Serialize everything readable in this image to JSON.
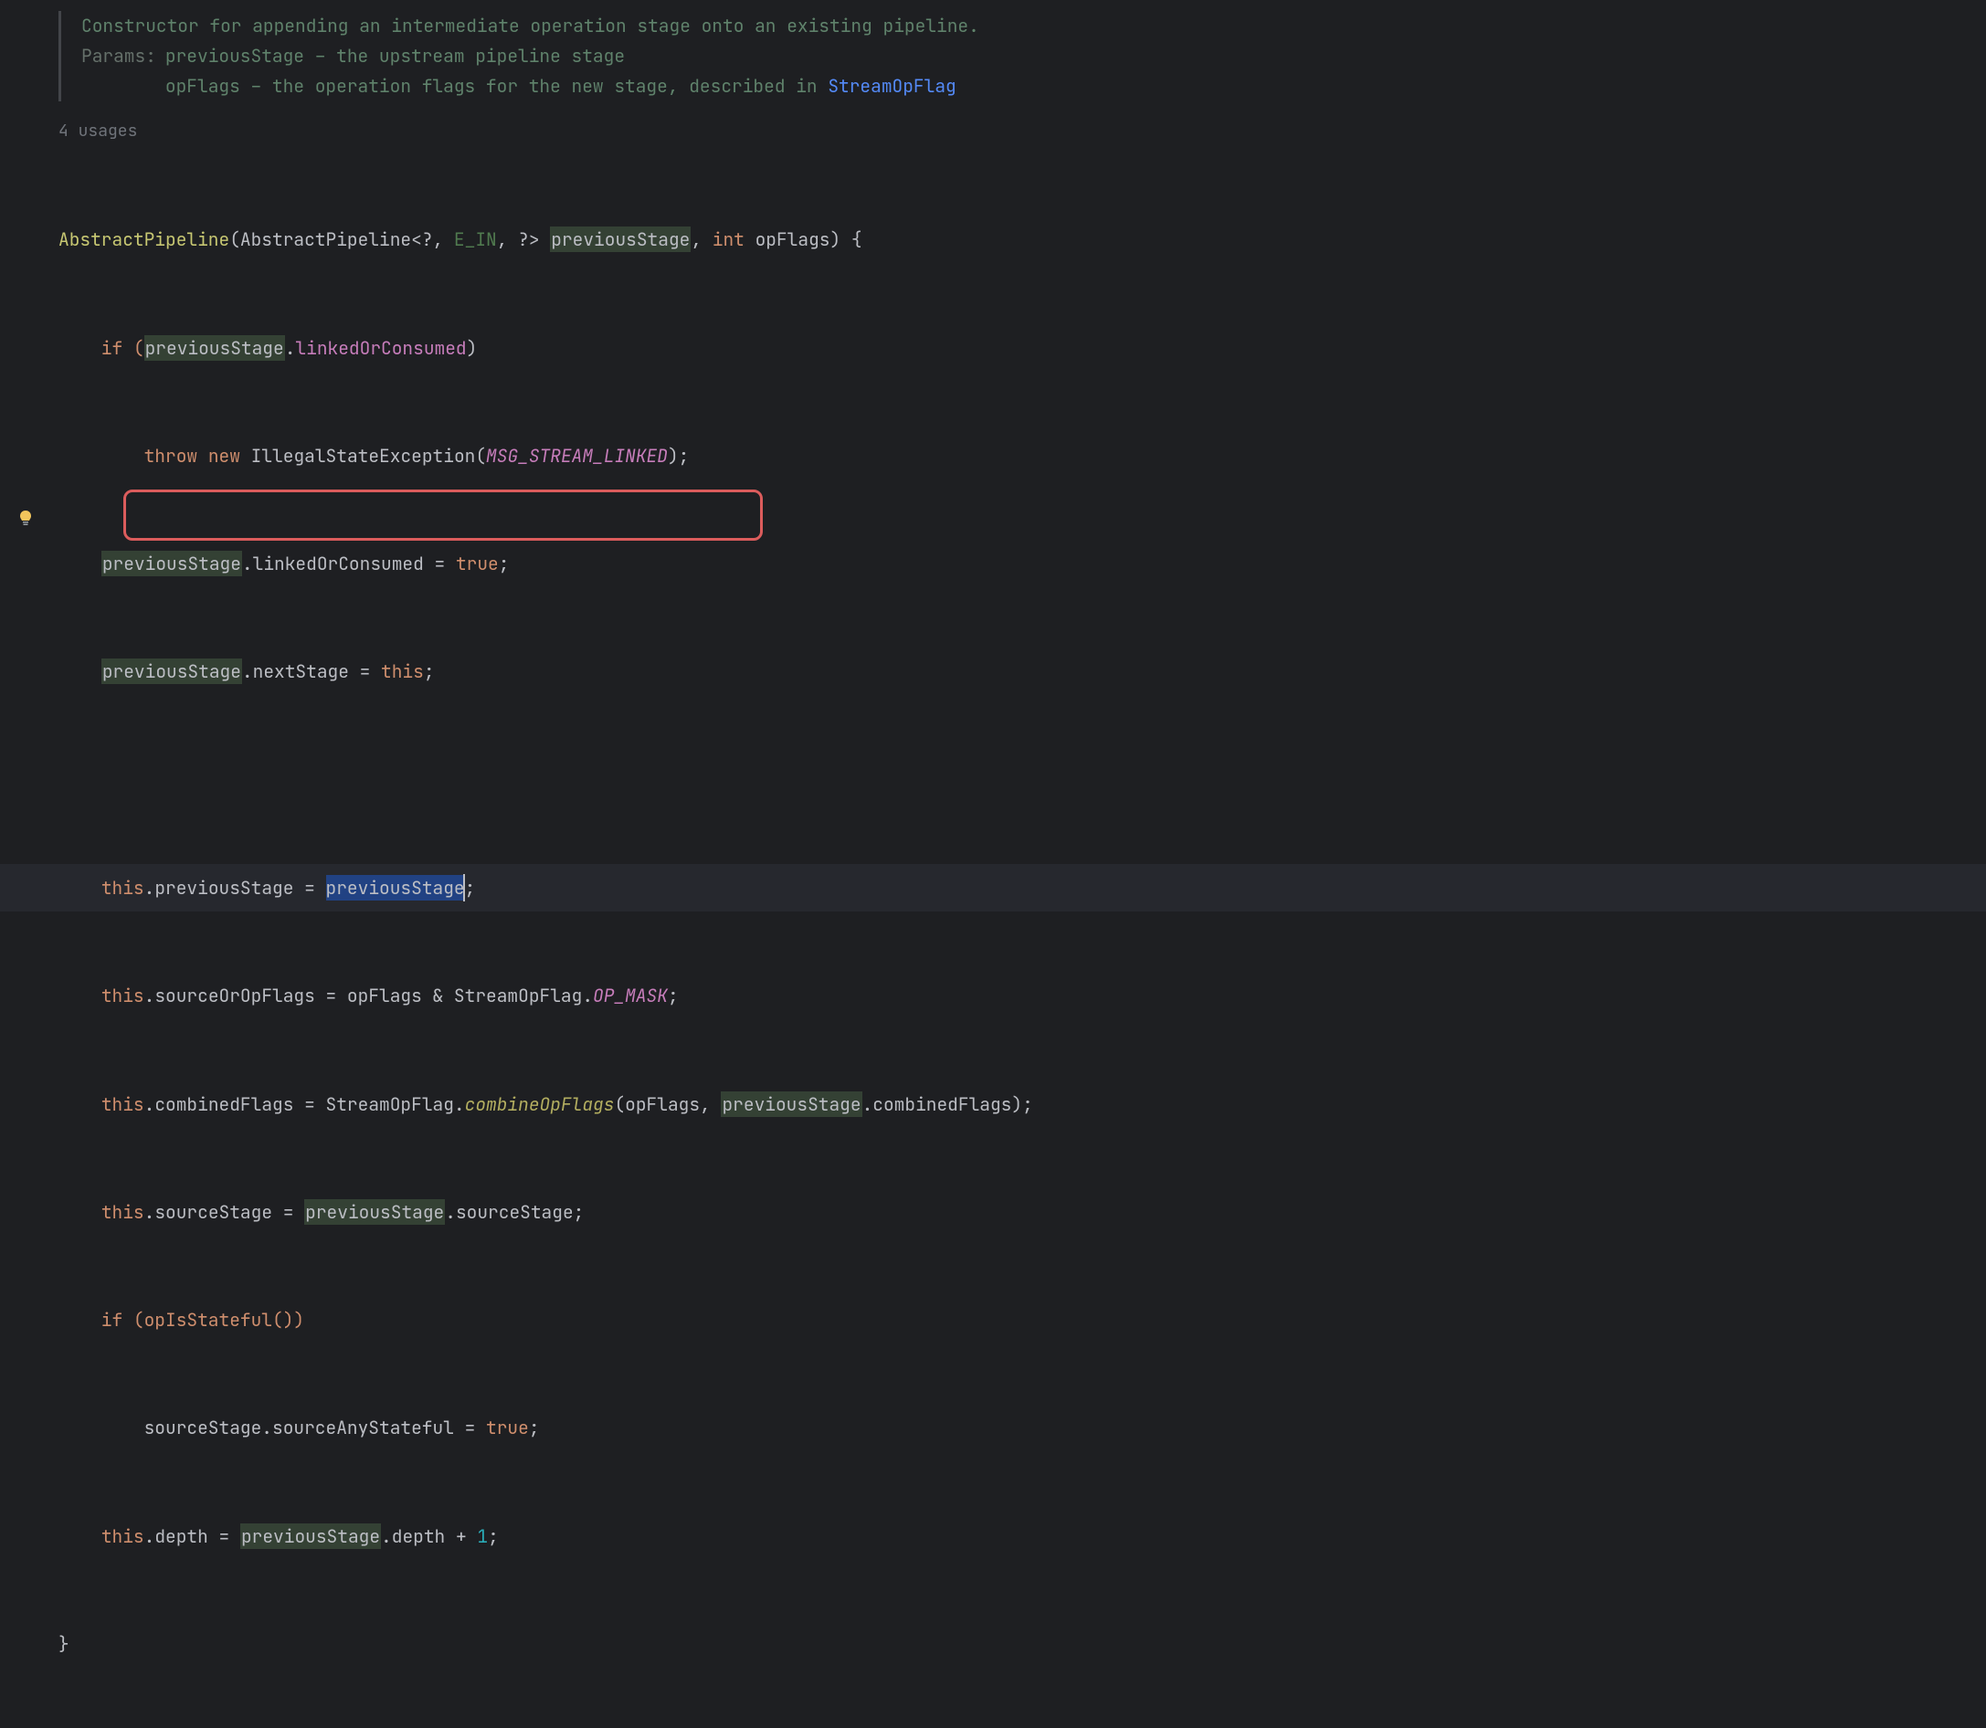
{
  "doc": {
    "summary": "Constructor for appending an intermediate operation stage onto an existing pipeline.",
    "params_label": "Params:",
    "param1_name": "previousStage",
    "param1_text": " – the upstream pipeline stage",
    "param2_name": "opFlags",
    "param2_text": " – the operation flags for the new stage, described in ",
    "param2_link": "StreamOpFlag"
  },
  "usages_text": "4 usages",
  "code": {
    "ctor_name": "AbstractPipeline",
    "ctor_paren_open": "(",
    "ctor_type": "AbstractPipeline",
    "gen_open": "<",
    "gen_q1": "?",
    "gen_c1": ", ",
    "gen_ein": "E_IN",
    "gen_c2": ", ",
    "gen_q2": "?",
    "gen_close": "> ",
    "p1": "previousStage",
    "c1": ", ",
    "kw_int": "int",
    "sp1": " ",
    "p2": "opFlags",
    "ctor_close": ") {",
    "if1": "    if (",
    "if1_var": "previousStage",
    "if1_dot": ".",
    "if1_field": "linkedOrConsumed",
    "if1_close": ")",
    "throw_indent": "        ",
    "kw_throw": "throw",
    "kw_new": "new",
    "exc": " IllegalStateException(",
    "msg": "MSG_STREAM_LINKED",
    "exc_close": ");",
    "l3a": "previousStage",
    "l3b": ".linkedOrConsumed = ",
    "l3c": "true",
    "l3d": ";",
    "l4a": "previousStage",
    "l4b": ".nextStage = ",
    "l4c": "this",
    "l4d": ";",
    "l5a": "this",
    "l5b": ".previousStage = ",
    "l5c": "previousStage",
    "l5d": ";",
    "l6a": "this",
    "l6b": ".sourceOrOpFlags = opFlags & StreamOpFlag.",
    "l6c": "OP_MASK",
    "l6d": ";",
    "l7a": "this",
    "l7b": ".combinedFlags = StreamOpFlag.",
    "l7c": "combineOpFlags",
    "l7d": "(opFlags, ",
    "l7e": "previousStage",
    "l7f": ".combinedFlags);",
    "l8a": "this",
    "l8b": ".sourceStage = ",
    "l8c": "previousStage",
    "l8d": ".sourceStage;",
    "l9a": "    if (opIsStateful())",
    "l10a": "        sourceStage.sourceAnyStateful = ",
    "l10b": "true",
    "l10c": ";",
    "l11a": "this",
    "l11b": ".depth = ",
    "l11c": "previousStage",
    "l11d": ".depth + ",
    "l11e": "1",
    "l11f": ";",
    "l12": "}"
  }
}
